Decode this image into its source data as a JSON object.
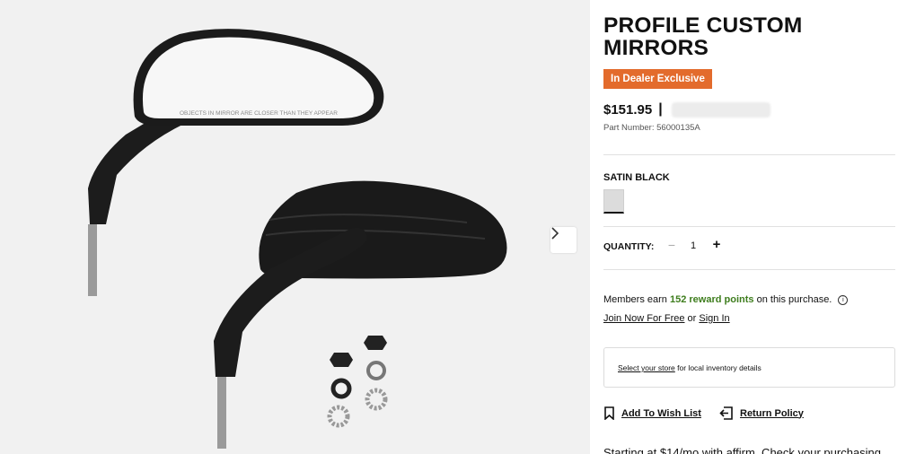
{
  "gallery": {
    "mirror_text": "OBJECTS IN MIRROR ARE CLOSER THAN THEY APPEAR",
    "next_icon": "chevron-right-icon"
  },
  "product": {
    "title": "PROFILE CUSTOM MIRRORS",
    "badge": "In Dealer Exclusive",
    "badge_color": "#e36b2c",
    "price": "$151.95",
    "price_separator": "|",
    "part_number_label": "Part Number:",
    "part_number": "56000135A"
  },
  "color": {
    "label": "SATIN BLACK",
    "swatch_color": "#dcdcdc"
  },
  "quantity": {
    "label": "QUANTITY:",
    "minus": "−",
    "value": "1",
    "plus": "+"
  },
  "rewards": {
    "prefix": "Members earn",
    "points": "152 reward points",
    "suffix": "on this purchase.",
    "points_color": "#3e7d1d",
    "join_link": "Join Now For Free",
    "or": "or",
    "sign_in_link": "Sign In"
  },
  "store": {
    "link": "Select your store",
    "text": "for local inventory details"
  },
  "actions": {
    "wishlist": "Add To Wish List",
    "return_policy": "Return Policy"
  },
  "affirm": {
    "text": "Starting at $14/mo with affirm. Check your purchasing"
  }
}
